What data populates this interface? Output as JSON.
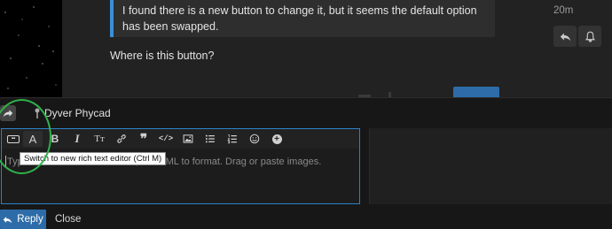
{
  "post": {
    "quote_text": "I found there is a new button to change it, but it seems the default option has been swapped.",
    "body_text": "Where is this button?",
    "time": "20m",
    "reply_icon": "reply-icon",
    "bell_icon": "bell-icon"
  },
  "composer": {
    "reply_to_user": "Dyver Phycad",
    "reply_to_icon": "share-arrow-icon",
    "toolbar": [
      {
        "name": "toggle-editor-mode",
        "icon": "toggle-pill-icon"
      },
      {
        "name": "font-style",
        "label": "A"
      },
      {
        "name": "bold",
        "label": "B"
      },
      {
        "name": "italic",
        "label": "I"
      },
      {
        "name": "heading",
        "label": "Tт"
      },
      {
        "name": "link",
        "icon": "link-icon"
      },
      {
        "name": "blockquote",
        "label": "❞"
      },
      {
        "name": "code",
        "label": "</>"
      },
      {
        "name": "image",
        "icon": "image-icon"
      },
      {
        "name": "bullet-list",
        "icon": "bullet-list-icon"
      },
      {
        "name": "numbered-list",
        "icon": "numbered-list-icon"
      },
      {
        "name": "emoji",
        "icon": "emoji-icon"
      },
      {
        "name": "more",
        "icon": "plus-circle-icon"
      }
    ],
    "tooltip": "Switch to new rich text editor (Ctrl M)",
    "placeholder": "Type here. Use Markdown, BBCode, or HTML to format. Drag or paste images.",
    "placeholder_visible_tail": "de, or HTML to format. Drag or paste images.",
    "placeholder_visible_head": "Typ",
    "reply_button": "Reply",
    "close_link": "Close"
  },
  "colors": {
    "accent": "#2d6ca8",
    "focus_border": "#2d82c8",
    "quote_border": "#3a8fd6",
    "highlight_circle": "#2fb24a"
  }
}
